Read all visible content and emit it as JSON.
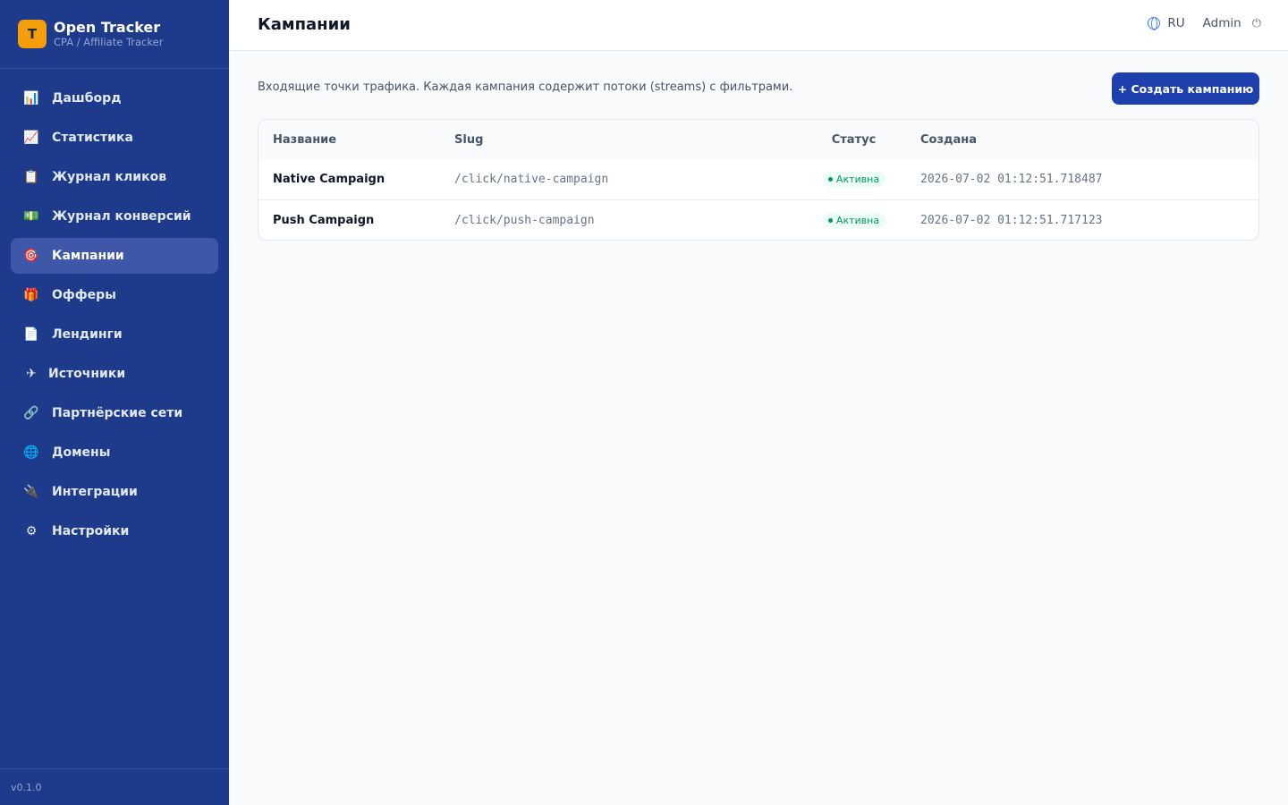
{
  "brand": {
    "logo_letter": "T",
    "name": "Open Tracker",
    "subtitle": "CPA / Affiliate Tracker"
  },
  "sidebar": {
    "items": [
      {
        "label": "Дашборд",
        "icon": "bar-chart-icon",
        "glyph": "📊",
        "active": false
      },
      {
        "label": "Статистика",
        "icon": "line-chart-icon",
        "glyph": "📈",
        "active": false
      },
      {
        "label": "Журнал кликов",
        "icon": "clipboard-icon",
        "glyph": "📋",
        "active": false
      },
      {
        "label": "Журнал конверсий",
        "icon": "money-icon",
        "glyph": "💵",
        "active": false
      },
      {
        "label": "Кампании",
        "icon": "target-icon",
        "glyph": "🎯",
        "active": true
      },
      {
        "label": "Офферы",
        "icon": "gift-icon",
        "glyph": "🎁",
        "active": false
      },
      {
        "label": "Лендинги",
        "icon": "document-icon",
        "glyph": "📄",
        "active": false
      },
      {
        "label": "Источники",
        "icon": "plane-icon",
        "glyph": "✈",
        "active": false
      },
      {
        "label": "Партнёрские сети",
        "icon": "link-icon",
        "glyph": "🔗",
        "active": false
      },
      {
        "label": "Домены",
        "icon": "globe-icon",
        "glyph": "🌐",
        "active": false
      },
      {
        "label": "Интеграции",
        "icon": "plug-icon",
        "glyph": "🔌",
        "active": false
      },
      {
        "label": "Настройки",
        "icon": "gear-icon",
        "glyph": "⚙",
        "active": false
      }
    ],
    "version": "v0.1.0"
  },
  "header": {
    "title": "Кампании",
    "language": "RU",
    "user": "Admin",
    "logout_glyph": "⏻"
  },
  "main": {
    "description": "Входящие точки трафика. Каждая кампания содержит потоки (streams) с фильтрами.",
    "create_button": "+ Создать кампанию",
    "columns": [
      "Название",
      "Slug",
      "Статус",
      "Создана"
    ],
    "rows": [
      {
        "name": "Native Campaign",
        "slug": "/click/native-campaign",
        "status": "Активна",
        "created": "2026-07-02 01:12:51.718487"
      },
      {
        "name": "Push Campaign",
        "slug": "/click/push-campaign",
        "status": "Активна",
        "created": "2026-07-02 01:12:51.717123"
      }
    ]
  },
  "colors": {
    "sidebar": "#1e3a8a",
    "active_item": "#3f57a8",
    "accent": "#1e40af",
    "logo": "#f59e0b",
    "status_active": "#059669"
  }
}
